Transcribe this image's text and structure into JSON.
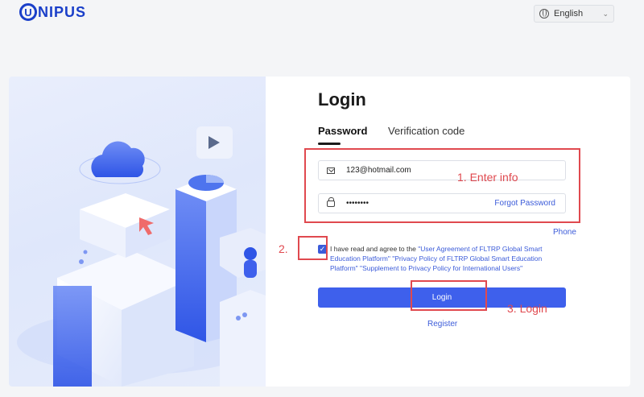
{
  "header": {
    "logo_letter": "U",
    "logo_rest": "NIPUS",
    "language": "English"
  },
  "login": {
    "title": "Login",
    "tabs": [
      "Password",
      "Verification code"
    ],
    "email_value": "123@hotmail.com",
    "password_value": "••••••••",
    "forgot_label": "Forgot Password",
    "phone_label": "Phone",
    "agree_prefix": "I have read and agree to the",
    "agree_links": [
      "\"User Agreement of FLTRP Global Smart Education Platform\"",
      "\"Privacy Policy of FLTRP Global Smart Education Platform\"",
      "\"Supplement to Privacy Policy for International Users\""
    ],
    "login_button": "Login",
    "register_label": "Register"
  },
  "annotations": {
    "step1": "1. Enter info",
    "step2": "2.",
    "step3": "3. Login",
    "color": "#e0494f"
  },
  "colors": {
    "brand": "#1a3fc9",
    "accent": "#3e60ec",
    "link": "#3b5bd9"
  }
}
